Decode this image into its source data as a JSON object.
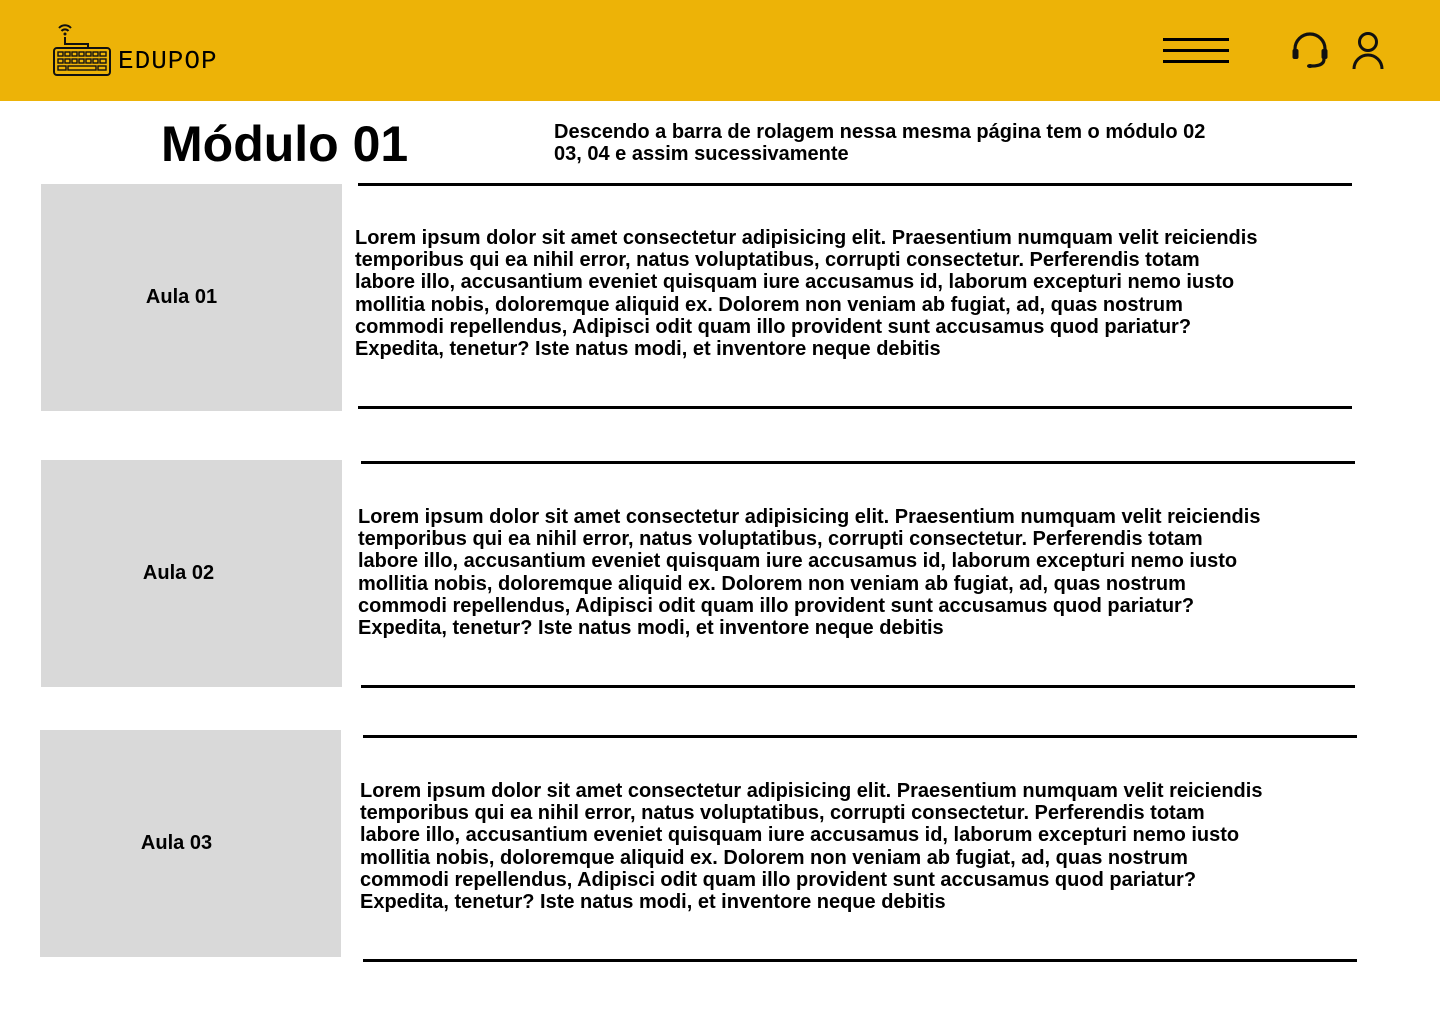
{
  "header": {
    "brand": "EDUPOP",
    "icons": [
      "keyboard-logo-icon",
      "menu-icon",
      "headset-icon",
      "user-icon"
    ],
    "background_color": "#EDB307"
  },
  "module": {
    "title": "Módulo 01",
    "note": "Descendo a barra de rolagem nessa mesma página tem o módulo 02\n03, 04 e assim sucessivamente"
  },
  "lessons": [
    {
      "label": "Aula 01",
      "text": "Lorem ipsum dolor sit amet consectetur adipisicing elit. Praesentium numquam velit reiciendis\n temporibus qui ea nihil error, natus voluptatibus, corrupti consectetur. Perferendis totam\nlabore illo, accusantium eveniet quisquam iure accusamus id, laborum excepturi nemo iusto\n mollitia nobis, doloremque aliquid ex. Dolorem non veniam ab fugiat, ad, quas nostrum\ncommodi repellendus, Adipisci odit quam illo provident sunt accusamus quod pariatur?\nExpedita, tenetur? Iste natus modi, et inventore neque debitis"
    },
    {
      "label": "Aula 02",
      "text": "Lorem ipsum dolor sit amet consectetur adipisicing elit. Praesentium numquam velit reiciendis\n temporibus qui ea nihil error, natus voluptatibus, corrupti consectetur. Perferendis totam\nlabore illo, accusantium eveniet quisquam iure accusamus id, laborum excepturi nemo iusto\n mollitia nobis, doloremque aliquid ex. Dolorem non veniam ab fugiat, ad, quas nostrum\ncommodi repellendus, Adipisci odit quam illo provident sunt accusamus quod pariatur?\nExpedita, tenetur? Iste natus modi, et inventore neque debitis"
    },
    {
      "label": "Aula 03",
      "text": "Lorem ipsum dolor sit amet consectetur adipisicing elit. Praesentium numquam velit reiciendis\n temporibus qui ea nihil error, natus voluptatibus, corrupti consectetur. Perferendis totam\nlabore illo, accusantium eveniet quisquam iure accusamus id, laborum excepturi nemo iusto\n mollitia nobis, doloremque aliquid ex. Dolorem non veniam ab fugiat, ad, quas nostrum\ncommodi repellendus, Adipisci odit quam illo provident sunt accusamus quod pariatur?\nExpedita, tenetur? Iste natus modi, et inventore neque debitis"
    }
  ]
}
